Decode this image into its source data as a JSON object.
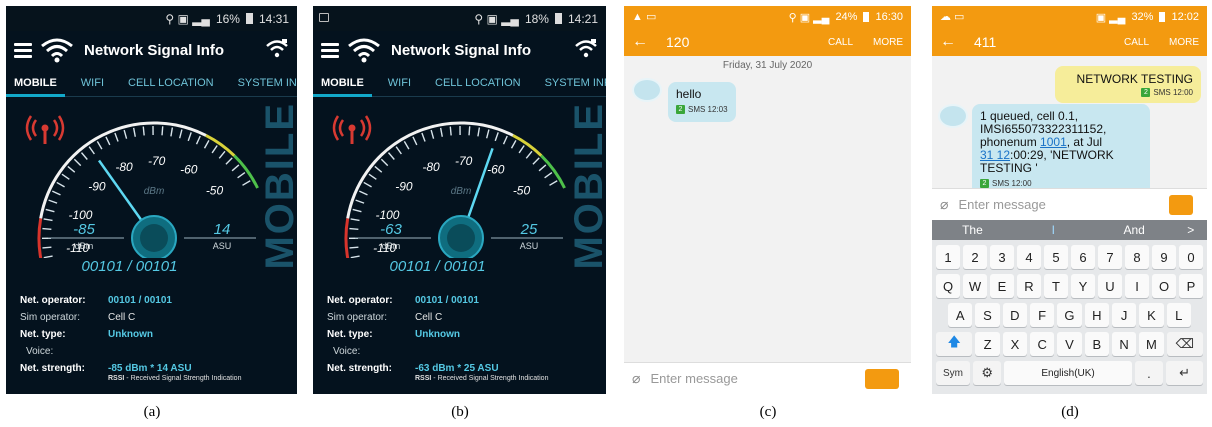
{
  "panel_a": {
    "status_text": "16% ",
    "status_time": "14:31",
    "app_title": "Network Signal Info",
    "tabs": [
      "MOBILE",
      "WIFI",
      "CELL LOCATION",
      "SYSTEM INF"
    ],
    "gauge_ticks": [
      "-110",
      "-100",
      "-90",
      "-80",
      "-70",
      "-60",
      "-50"
    ],
    "gauge_unit": "dBm",
    "dbm_value": "-85",
    "dbm_label": "dBm",
    "asu_value": "14",
    "asu_label": "ASU",
    "needle_dbm": -85,
    "vertical_label": "MOBILE",
    "mcc_mnc": "00101 / 00101",
    "info": {
      "net_operator_key": "Net. operator:",
      "net_operator_val": "00101 / 00101",
      "sim_operator_key": "Sim operator:",
      "sim_operator_val": "Cell C",
      "net_type_key": "Net. type:",
      "net_type_val": "Unknown",
      "voice_key": "Voice:",
      "net_strength_key": "Net. strength:",
      "net_strength_val": "-85 dBm * 14 ASU",
      "rssi_bold": "RSSI",
      "rssi_text": " - Received Signal Strength Indication"
    }
  },
  "panel_b": {
    "status_text": "18% ",
    "status_time": "14:21",
    "app_title": "Network Signal Info",
    "tabs": [
      "MOBILE",
      "WIFI",
      "CELL LOCATION",
      "SYSTEM INF"
    ],
    "gauge_ticks": [
      "-110",
      "-100",
      "-90",
      "-80",
      "-70",
      "-60",
      "-50"
    ],
    "gauge_unit": "dBm",
    "dbm_value": "-63",
    "dbm_label": "dBm",
    "asu_value": "25",
    "asu_label": "ASU",
    "needle_dbm": -63,
    "vertical_label": "MOBILE",
    "mcc_mnc": "00101 / 00101",
    "info": {
      "net_operator_key": "Net. operator:",
      "net_operator_val": "00101 / 00101",
      "sim_operator_key": "Sim operator:",
      "sim_operator_val": "Cell C",
      "net_type_key": "Net. type:",
      "net_type_val": "Unknown",
      "voice_key": "Voice:",
      "net_strength_key": "Net. strength:",
      "net_strength_val": "-63 dBm * 25 ASU",
      "rssi_bold": "RSSI",
      "rssi_text": " - Received Signal Strength Indication"
    }
  },
  "panel_c": {
    "status_text": "24%",
    "status_time": "16:30",
    "contact": "120",
    "call": "CALL",
    "more": "MORE",
    "date": "Friday, 31 July 2020",
    "message": "hello",
    "message_meta": "SMS 12:03",
    "compose_placeholder": "Enter message"
  },
  "panel_d": {
    "status_text": "32%",
    "status_time": "12:02",
    "contact": "411",
    "call": "CALL",
    "more": "MORE",
    "out_message": "NETWORK TESTING",
    "out_meta": "SMS 12:00",
    "in_line1": "1 queued, cell 0.1,",
    "in_line2": "IMSI655073322311152,",
    "in_line3_pre": "phonenum ",
    "in_line3_link": "1001",
    "in_line3_post": ", at Jul",
    "in_line4_link": "31 12",
    "in_line4_post": ":00:29, 'NETWORK",
    "in_line5": "TESTING '",
    "in_meta": "SMS 12:00",
    "compose_placeholder": "Enter message",
    "suggestions": [
      "The",
      "I",
      "And",
      ">"
    ],
    "keys_row1": [
      "1",
      "2",
      "3",
      "4",
      "5",
      "6",
      "7",
      "8",
      "9",
      "0"
    ],
    "keys_row2": [
      "Q",
      "W",
      "E",
      "R",
      "T",
      "Y",
      "U",
      "I",
      "O",
      "P"
    ],
    "keys_row3": [
      "A",
      "S",
      "D",
      "F",
      "G",
      "H",
      "J",
      "K",
      "L"
    ],
    "keys_row4": [
      "Z",
      "X",
      "C",
      "V",
      "B",
      "N",
      "M"
    ],
    "key_sym": "Sym",
    "key_space": "English(UK)"
  },
  "captions": [
    "(a)",
    "(b)",
    "(c)",
    "(d)"
  ]
}
